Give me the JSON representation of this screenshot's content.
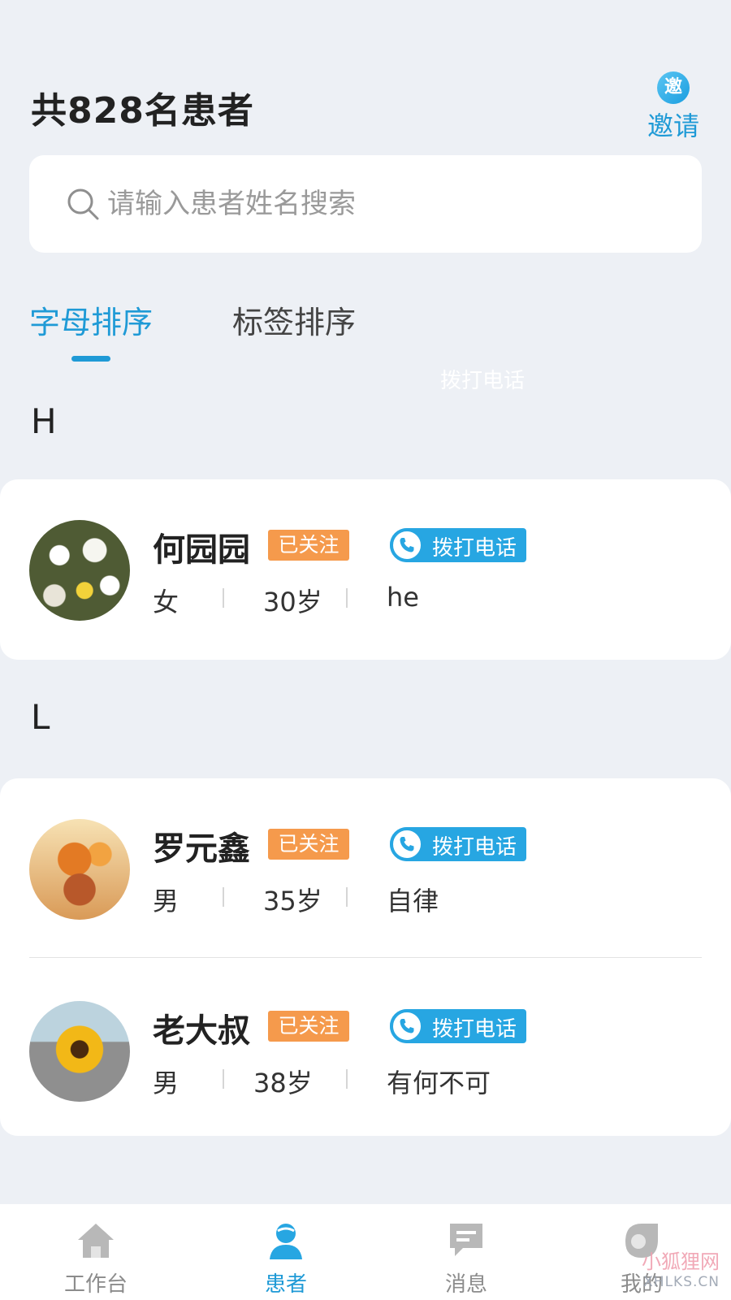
{
  "header": {
    "title": "共828名患者",
    "invite_badge": "邀",
    "invite_label": "邀请"
  },
  "search": {
    "placeholder": "请输入患者姓名搜索"
  },
  "tabs": [
    {
      "label": "字母排序",
      "active": true
    },
    {
      "label": "标签排序",
      "active": false
    }
  ],
  "ghost_text": "拨打电话",
  "groups": [
    {
      "letter": "H",
      "patients": [
        {
          "name": "何园园",
          "badge": "已关注",
          "call_label": "拨打电话",
          "gender": "女",
          "age": "30岁",
          "tag": "he"
        }
      ]
    },
    {
      "letter": "L",
      "patients": [
        {
          "name": "罗元鑫",
          "badge": "已关注",
          "call_label": "拨打电话",
          "gender": "男",
          "age": "35岁",
          "tag": "自律"
        },
        {
          "name": "老大叔",
          "badge": "已关注",
          "call_label": "拨打电话",
          "gender": "男",
          "age": "38岁",
          "tag": "有何不可"
        }
      ]
    }
  ],
  "bottom_nav": [
    {
      "label": "工作台",
      "icon": "home-icon",
      "active": false
    },
    {
      "label": "患者",
      "icon": "patient-icon",
      "active": true
    },
    {
      "label": "消息",
      "icon": "message-icon",
      "active": false
    },
    {
      "label": "我的",
      "icon": "profile-icon",
      "active": false
    }
  ],
  "watermark": {
    "text": "小狐狸网",
    "url": "XHLKS.CN"
  },
  "colors": {
    "accent": "#1f9ad6",
    "follow_badge": "#f59a4c",
    "background": "#edf0f5"
  }
}
